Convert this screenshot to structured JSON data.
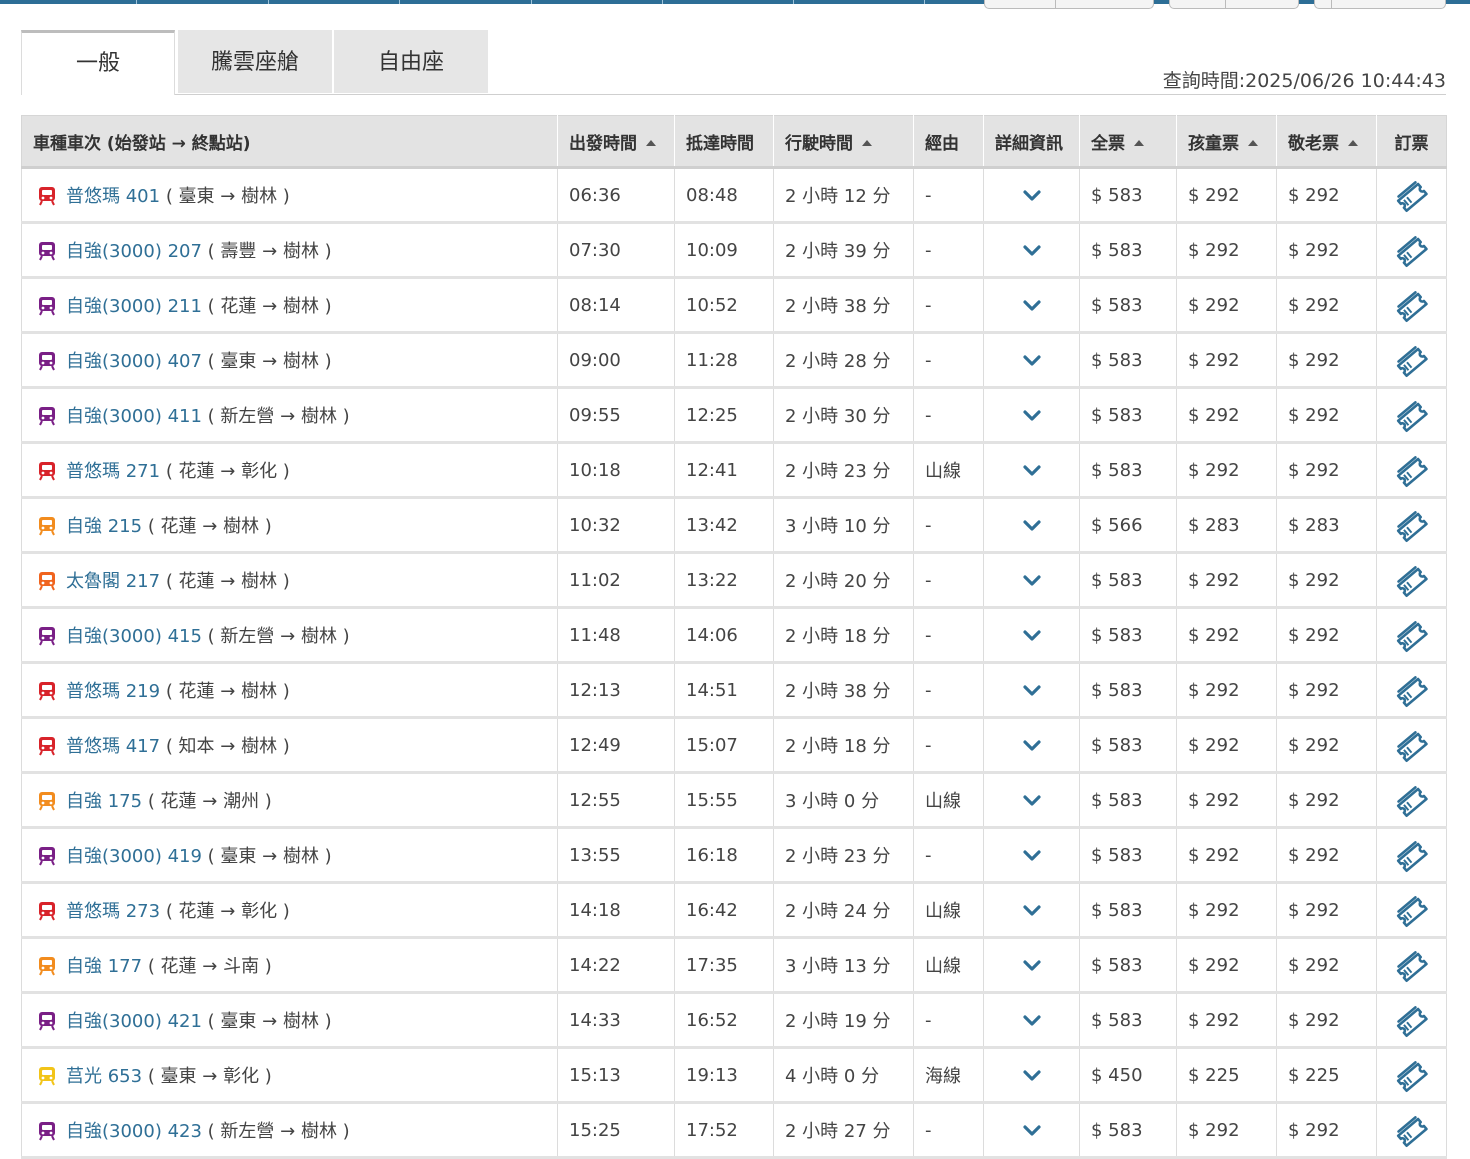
{
  "tabs": [
    {
      "label": "一般",
      "active": true
    },
    {
      "label": "騰雲座艙",
      "active": false
    },
    {
      "label": "自由座",
      "active": false
    }
  ],
  "query_time": "查詢時間:2025/06/26 10:44:43",
  "columns": [
    {
      "label": "車種車次 (始發站 → 終點站)",
      "sortable": false
    },
    {
      "label": "出發時間",
      "sortable": true
    },
    {
      "label": "抵達時間",
      "sortable": false
    },
    {
      "label": "行駛時間",
      "sortable": true
    },
    {
      "label": "經由",
      "sortable": false
    },
    {
      "label": "詳細資訊",
      "sortable": false
    },
    {
      "label": "全票",
      "sortable": true
    },
    {
      "label": "孩童票",
      "sortable": true
    },
    {
      "label": "敬老票",
      "sortable": true
    },
    {
      "label": "訂票",
      "sortable": false
    }
  ],
  "colors": {
    "tzuchiang3000": "#7a1f86",
    "puyuma": "#d8232a",
    "tzuchiang": "#f28c1e",
    "taroko": "#f0641e",
    "chukuang": "#f2c418",
    "link": "#2f6f96"
  },
  "rows": [
    {
      "train": "普悠瑪 401",
      "route": "( 臺東 → 樹林 )",
      "icon_color": "#d8232a",
      "dep": "06:36",
      "arr": "08:48",
      "dur": "2 小時 12 分",
      "via": "-",
      "full": "$ 583",
      "child": "$ 292",
      "senior": "$ 292"
    },
    {
      "train": "自強(3000) 207",
      "route": "( 壽豐 → 樹林 )",
      "icon_color": "#7a1f86",
      "dep": "07:30",
      "arr": "10:09",
      "dur": "2 小時 39 分",
      "via": "-",
      "full": "$ 583",
      "child": "$ 292",
      "senior": "$ 292"
    },
    {
      "train": "自強(3000) 211",
      "route": "( 花蓮 → 樹林 )",
      "icon_color": "#7a1f86",
      "dep": "08:14",
      "arr": "10:52",
      "dur": "2 小時 38 分",
      "via": "-",
      "full": "$ 583",
      "child": "$ 292",
      "senior": "$ 292"
    },
    {
      "train": "自強(3000) 407",
      "route": "( 臺東 → 樹林 )",
      "icon_color": "#7a1f86",
      "dep": "09:00",
      "arr": "11:28",
      "dur": "2 小時 28 分",
      "via": "-",
      "full": "$ 583",
      "child": "$ 292",
      "senior": "$ 292"
    },
    {
      "train": "自強(3000) 411",
      "route": "( 新左營 → 樹林 )",
      "icon_color": "#7a1f86",
      "dep": "09:55",
      "arr": "12:25",
      "dur": "2 小時 30 分",
      "via": "-",
      "full": "$ 583",
      "child": "$ 292",
      "senior": "$ 292"
    },
    {
      "train": "普悠瑪 271",
      "route": "( 花蓮 → 彰化 )",
      "icon_color": "#d8232a",
      "dep": "10:18",
      "arr": "12:41",
      "dur": "2 小時 23 分",
      "via": "山線",
      "full": "$ 583",
      "child": "$ 292",
      "senior": "$ 292"
    },
    {
      "train": "自強 215",
      "route": "( 花蓮 → 樹林 )",
      "icon_color": "#f28c1e",
      "dep": "10:32",
      "arr": "13:42",
      "dur": "3 小時 10 分",
      "via": "-",
      "full": "$ 566",
      "child": "$ 283",
      "senior": "$ 283"
    },
    {
      "train": "太魯閣 217",
      "route": "( 花蓮 → 樹林 )",
      "icon_color": "#f0641e",
      "dep": "11:02",
      "arr": "13:22",
      "dur": "2 小時 20 分",
      "via": "-",
      "full": "$ 583",
      "child": "$ 292",
      "senior": "$ 292"
    },
    {
      "train": "自強(3000) 415",
      "route": "( 新左營 → 樹林 )",
      "icon_color": "#7a1f86",
      "dep": "11:48",
      "arr": "14:06",
      "dur": "2 小時 18 分",
      "via": "-",
      "full": "$ 583",
      "child": "$ 292",
      "senior": "$ 292"
    },
    {
      "train": "普悠瑪 219",
      "route": "( 花蓮 → 樹林 )",
      "icon_color": "#d8232a",
      "dep": "12:13",
      "arr": "14:51",
      "dur": "2 小時 38 分",
      "via": "-",
      "full": "$ 583",
      "child": "$ 292",
      "senior": "$ 292"
    },
    {
      "train": "普悠瑪 417",
      "route": "( 知本 → 樹林 )",
      "icon_color": "#d8232a",
      "dep": "12:49",
      "arr": "15:07",
      "dur": "2 小時 18 分",
      "via": "-",
      "full": "$ 583",
      "child": "$ 292",
      "senior": "$ 292"
    },
    {
      "train": "自強 175",
      "route": "( 花蓮 → 潮州 )",
      "icon_color": "#f28c1e",
      "dep": "12:55",
      "arr": "15:55",
      "dur": "3 小時 0 分",
      "via": "山線",
      "full": "$ 583",
      "child": "$ 292",
      "senior": "$ 292"
    },
    {
      "train": "自強(3000) 419",
      "route": "( 臺東 → 樹林 )",
      "icon_color": "#7a1f86",
      "dep": "13:55",
      "arr": "16:18",
      "dur": "2 小時 23 分",
      "via": "-",
      "full": "$ 583",
      "child": "$ 292",
      "senior": "$ 292"
    },
    {
      "train": "普悠瑪 273",
      "route": "( 花蓮 → 彰化 )",
      "icon_color": "#d8232a",
      "dep": "14:18",
      "arr": "16:42",
      "dur": "2 小時 24 分",
      "via": "山線",
      "full": "$ 583",
      "child": "$ 292",
      "senior": "$ 292"
    },
    {
      "train": "自強 177",
      "route": "( 花蓮 → 斗南 )",
      "icon_color": "#f28c1e",
      "dep": "14:22",
      "arr": "17:35",
      "dur": "3 小時 13 分",
      "via": "山線",
      "full": "$ 583",
      "child": "$ 292",
      "senior": "$ 292"
    },
    {
      "train": "自強(3000) 421",
      "route": "( 臺東 → 樹林 )",
      "icon_color": "#7a1f86",
      "dep": "14:33",
      "arr": "16:52",
      "dur": "2 小時 19 分",
      "via": "-",
      "full": "$ 583",
      "child": "$ 292",
      "senior": "$ 292"
    },
    {
      "train": "莒光 653",
      "route": "( 臺東 → 彰化 )",
      "icon_color": "#f2c418",
      "dep": "15:13",
      "arr": "19:13",
      "dur": "4 小時 0 分",
      "via": "海線",
      "full": "$ 450",
      "child": "$ 225",
      "senior": "$ 225"
    },
    {
      "train": "自強(3000) 423",
      "route": "( 新左營 → 樹林 )",
      "icon_color": "#7a1f86",
      "dep": "15:25",
      "arr": "17:52",
      "dur": "2 小時 27 分",
      "via": "-",
      "full": "$ 583",
      "child": "$ 292",
      "senior": "$ 292"
    }
  ]
}
